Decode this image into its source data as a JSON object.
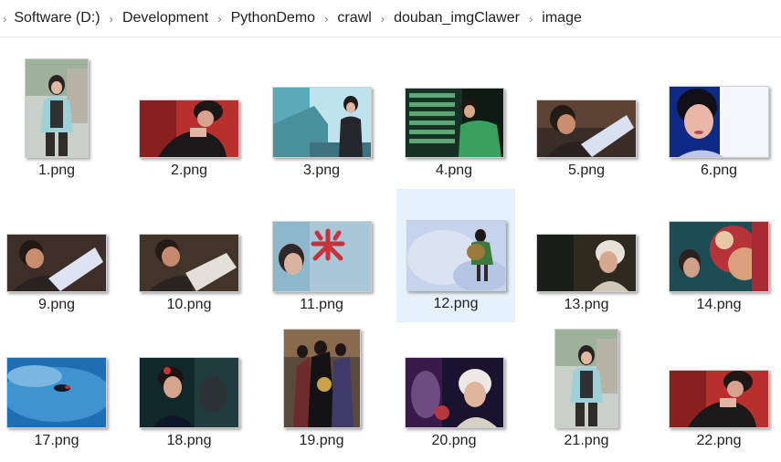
{
  "breadcrumb": {
    "items": [
      "Software (D:)",
      "Development",
      "PythonDemo",
      "crawl",
      "douban_imgClawer",
      "image"
    ],
    "separator": "›"
  },
  "files": [
    {
      "name": "1.png"
    },
    {
      "name": "2.png"
    },
    {
      "name": "3.png"
    },
    {
      "name": "4.png"
    },
    {
      "name": "5.png"
    },
    {
      "name": "6.png"
    },
    {
      "name": "9.png"
    },
    {
      "name": "10.png"
    },
    {
      "name": "11.png"
    },
    {
      "name": "12.png",
      "selected": true
    },
    {
      "name": "13.png"
    },
    {
      "name": "14.png"
    },
    {
      "name": "17.png"
    },
    {
      "name": "18.png"
    },
    {
      "name": "19.png"
    },
    {
      "name": "20.png"
    },
    {
      "name": "21.png"
    },
    {
      "name": "22.png"
    }
  ],
  "colors": {
    "selection": "#e5f1fb",
    "separator": "#7a7a7a"
  }
}
